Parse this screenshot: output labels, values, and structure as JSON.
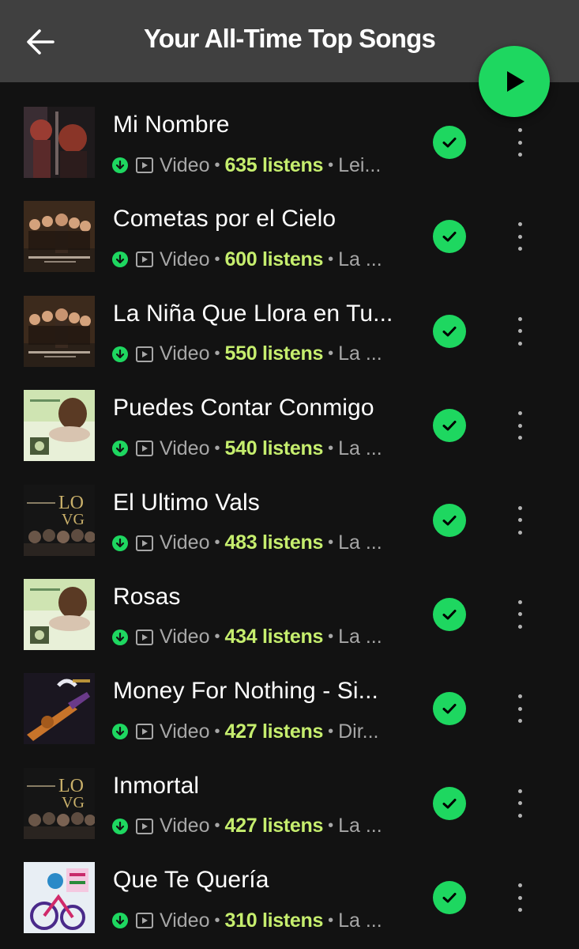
{
  "header": {
    "title": "Your All-Time Top Songs"
  },
  "colors": {
    "accent": "#1ed760",
    "listens": "#c6ee6e",
    "header_bg": "#404040",
    "page_bg": "#121212",
    "muted_text": "#a7a7a7"
  },
  "songs": [
    {
      "title": "Mi Nombre",
      "type": "Video",
      "listens": "635 listens",
      "artist": "Lei...",
      "cover": "mi-nombre-cover"
    },
    {
      "title": "Cometas por el Cielo",
      "type": "Video",
      "listens": "600 listens",
      "artist": "La ...",
      "cover": "cometas-cover"
    },
    {
      "title": "La Niña Que Llora en Tu...",
      "type": "Video",
      "listens": "550 listens",
      "artist": "La ...",
      "cover": "cometas-cover"
    },
    {
      "title": "Puedes Contar Conmigo",
      "type": "Video",
      "listens": "540 listens",
      "artist": "La ...",
      "cover": "puedes-cover"
    },
    {
      "title": "El Ultimo Vals",
      "type": "Video",
      "listens": "483 listens",
      "artist": "La ...",
      "cover": "vals-cover"
    },
    {
      "title": "Rosas",
      "type": "Video",
      "listens": "434 listens",
      "artist": "La ...",
      "cover": "puedes-cover"
    },
    {
      "title": "Money For Nothing - Si...",
      "type": "Video",
      "listens": "427 listens",
      "artist": "Dir...",
      "cover": "money-cover"
    },
    {
      "title": "Inmortal",
      "type": "Video",
      "listens": "427 listens",
      "artist": "La ...",
      "cover": "vals-cover"
    },
    {
      "title": "Que Te Quería",
      "type": "Video",
      "listens": "310 listens",
      "artist": "La ...",
      "cover": "quetequeria-cover"
    }
  ]
}
